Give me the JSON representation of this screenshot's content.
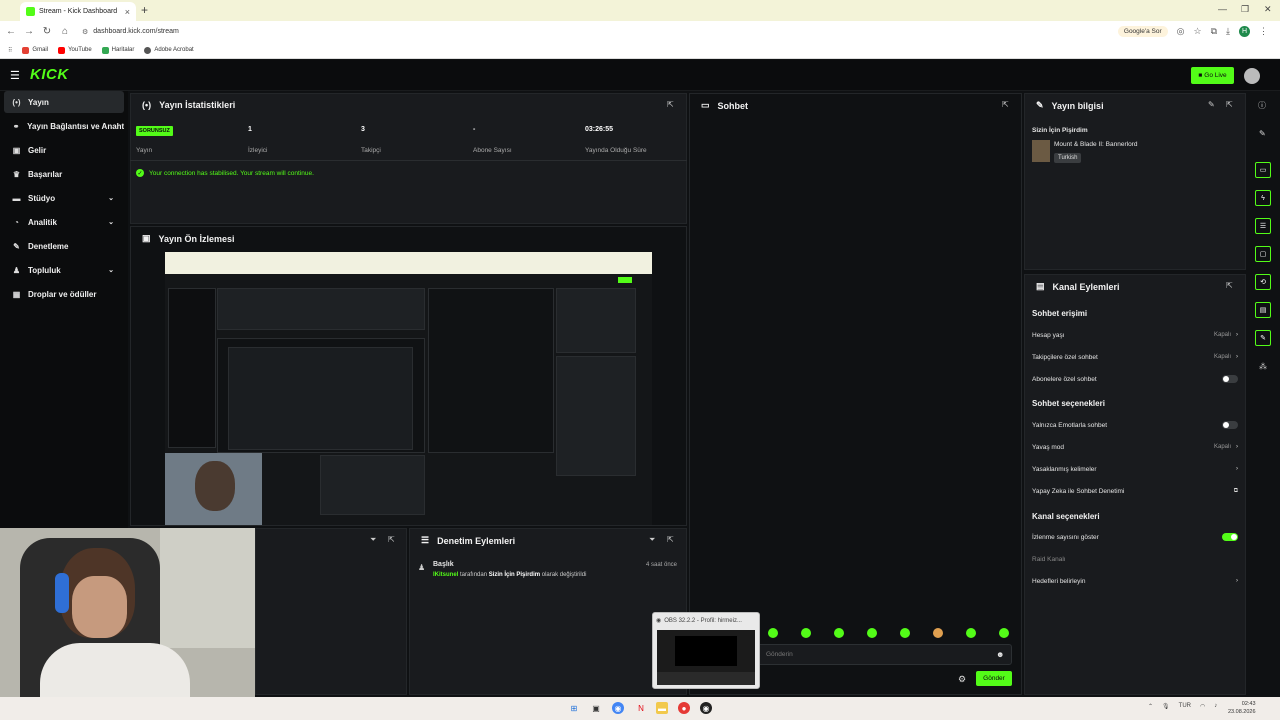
{
  "browser": {
    "tab_title": "Stream - Kick Dashboard",
    "url": "dashboard.kick.com/stream",
    "google_sor": "Google'a Sor",
    "profile_initial": "H",
    "bookmarks": [
      "Gmail",
      "YouTube",
      "Haritalar",
      "Adobe Acrobat"
    ]
  },
  "header": {
    "logo": "KICK",
    "go_live": "Go Live"
  },
  "sidebar": {
    "items": [
      {
        "label": "Yayın",
        "icon": "broadcast-icon"
      },
      {
        "label": "Yayın Bağlantısı ve Anahtarı",
        "icon": "link-icon"
      },
      {
        "label": "Gelir",
        "icon": "wallet-icon"
      },
      {
        "label": "Başarılar",
        "icon": "trophy-icon"
      },
      {
        "label": "Stüdyo",
        "icon": "studio-icon"
      },
      {
        "label": "Analitik",
        "icon": "chart-icon"
      },
      {
        "label": "Denetleme",
        "icon": "wrench-icon"
      },
      {
        "label": "Topluluk",
        "icon": "community-icon"
      },
      {
        "label": "Droplar ve ödüller",
        "icon": "gift-icon"
      }
    ]
  },
  "stats": {
    "title": "Yayın İstatistikleri",
    "status_badge": "SORUNSUZ",
    "status_label": "Yayın",
    "viewers_value": "1",
    "viewers_label": "İzleyici",
    "followers_value": "3",
    "followers_label": "Takipçi",
    "subs_value": "-",
    "subs_label": "Abone Sayısı",
    "uptime_value": "03:26:55",
    "uptime_label": "Yayında Olduğu Süre",
    "connection_message": "Your connection has stabilised. Your stream will continue."
  },
  "preview": {
    "title": "Yayın Ön İzlemesi"
  },
  "moderation": {
    "title": "Denetim Eylemleri",
    "entry_title": "Başlık",
    "entry_user": "IKitsunel",
    "entry_text_1": "tarafından",
    "entry_value": "Sizin İçin Pişirdim",
    "entry_text_2": "olarak değiştirildi",
    "entry_time": "4 saat önce"
  },
  "chat": {
    "title": "Sohbet",
    "input_placeholder": "Gönderin",
    "send_button": "Gönder"
  },
  "obs_popup": {
    "title": "OBS 32.2.2 - Profil: hirmeiz..."
  },
  "stream_info": {
    "title": "Yayın bilgisi",
    "stream_title": "Sizin İçin Pişirdim",
    "game": "Mount & Blade II: Bannerlord",
    "language_tag": "Turkish"
  },
  "channel_actions": {
    "title": "Kanal Eylemleri",
    "chat_access_heading": "Sohbet erişimi",
    "account_age": "Hesap yaşı",
    "account_age_value": "Kapalı",
    "followers_only": "Takipçilere özel sohbet",
    "followers_only_value": "Kapalı",
    "subs_only": "Abonelere özel sohbet",
    "chat_options_heading": "Sohbet seçenekleri",
    "emote_only": "Yalnızca Emotlarla sohbet",
    "slow_mode": "Yavaş mod",
    "slow_mode_value": "Kapalı",
    "banned_words": "Yasaklanmış kelimeler",
    "ai_moderation": "Yapay Zeka ile Sohbet Denetimi",
    "channel_options_heading": "Kanal seçenekleri",
    "show_viewer_count": "İzlenme sayısını göster",
    "raid_channel": "Raid Kanalı",
    "set_targets": "Hedefleri belirleyin",
    "toggles": {
      "subs_only": false,
      "emote_only": false,
      "show_viewer_count": true
    }
  },
  "taskbar": {
    "lang": "TUR",
    "time": "02:43",
    "date": "23.08.2026"
  },
  "colors": {
    "accent": "#53fc18",
    "panel": "#191b1e",
    "background": "#0f1113"
  }
}
